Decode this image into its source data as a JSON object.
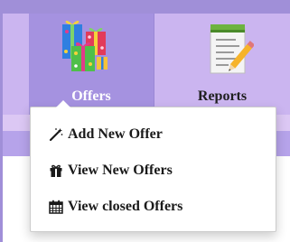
{
  "nav": {
    "items": [
      {
        "label": "Offers",
        "icon": "gift-boxes-icon",
        "active": true
      },
      {
        "label": "Reports",
        "icon": "report-notepad-icon",
        "active": false
      }
    ]
  },
  "dropdown": {
    "items": [
      {
        "label": "Add New Offer",
        "icon": "magic-wand-icon"
      },
      {
        "label": "View New Offers",
        "icon": "gift-icon"
      },
      {
        "label": "View closed Offers",
        "icon": "calendar-icon"
      }
    ]
  },
  "colors": {
    "nav_background": "#cbb5f0",
    "active_nav_background": "#a592e0",
    "top_strip": "#a08fd8"
  }
}
